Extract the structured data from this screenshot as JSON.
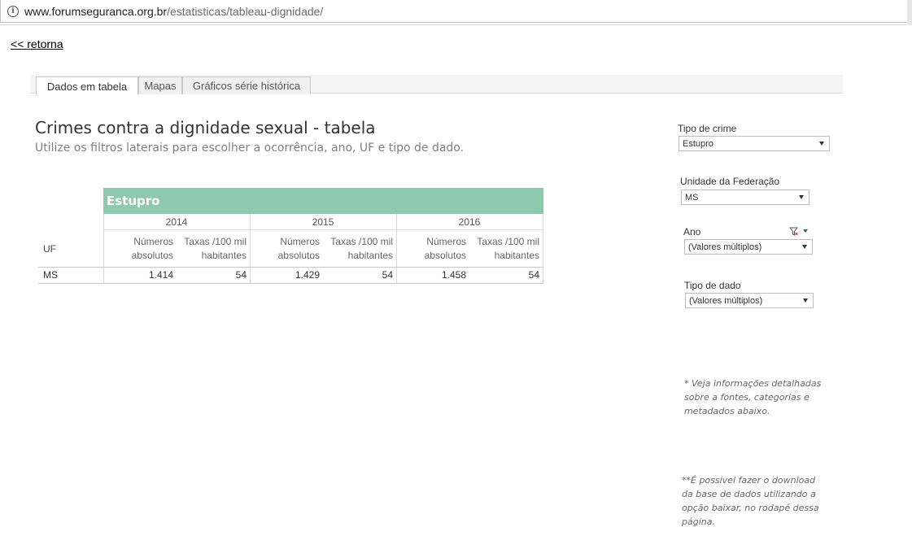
{
  "browser": {
    "url_domain": "www.forumseguranca.org.br",
    "url_path": "/estatisticas/tableau-dignidade/"
  },
  "back_link": "<< retorna",
  "tabs": [
    {
      "label": "Dados em tabela",
      "active": true
    },
    {
      "label": "Mapas",
      "active": false
    },
    {
      "label": "Gráficos série histórica",
      "active": false
    }
  ],
  "page": {
    "title": "Crimes contra a dignidade sexual - tabela",
    "subtitle": "Utilize os filtros laterais para escolher a ocorrência, ano, UF e tipo de dado."
  },
  "table": {
    "group_header": "Estupro",
    "row_header": "UF",
    "years": [
      "2014",
      "2015",
      "2016"
    ],
    "measure_1": [
      "Números",
      "absolutos"
    ],
    "measure_2": [
      "Taxas /100 mil",
      "habitantes"
    ],
    "rows": [
      {
        "uf": "MS",
        "values": [
          "1.414",
          "54",
          "1.429",
          "54",
          "1.458",
          "54"
        ]
      }
    ],
    "header_color": "#8ec8ad"
  },
  "filters": {
    "tipo_crime": {
      "label": "Tipo de crime",
      "value": "Estupro"
    },
    "uf": {
      "label": "Unidade da Federação",
      "value": "MS"
    },
    "ano": {
      "label": "Ano",
      "value": "(Valores múltiplos)",
      "icon": "clear-filter-icon"
    },
    "tipo_dado": {
      "label": "Tipo de dado",
      "value": "(Valores múltiplos)"
    }
  },
  "notes": {
    "note1": [
      "* Veja informações detalhadas",
      "sobre a fontes, categorias e",
      "metadados abaixo."
    ],
    "note2": [
      "**É possível fazer o download",
      "da base de dados utilizando a",
      "opção baixar, no rodapé dessa",
      "página."
    ]
  }
}
